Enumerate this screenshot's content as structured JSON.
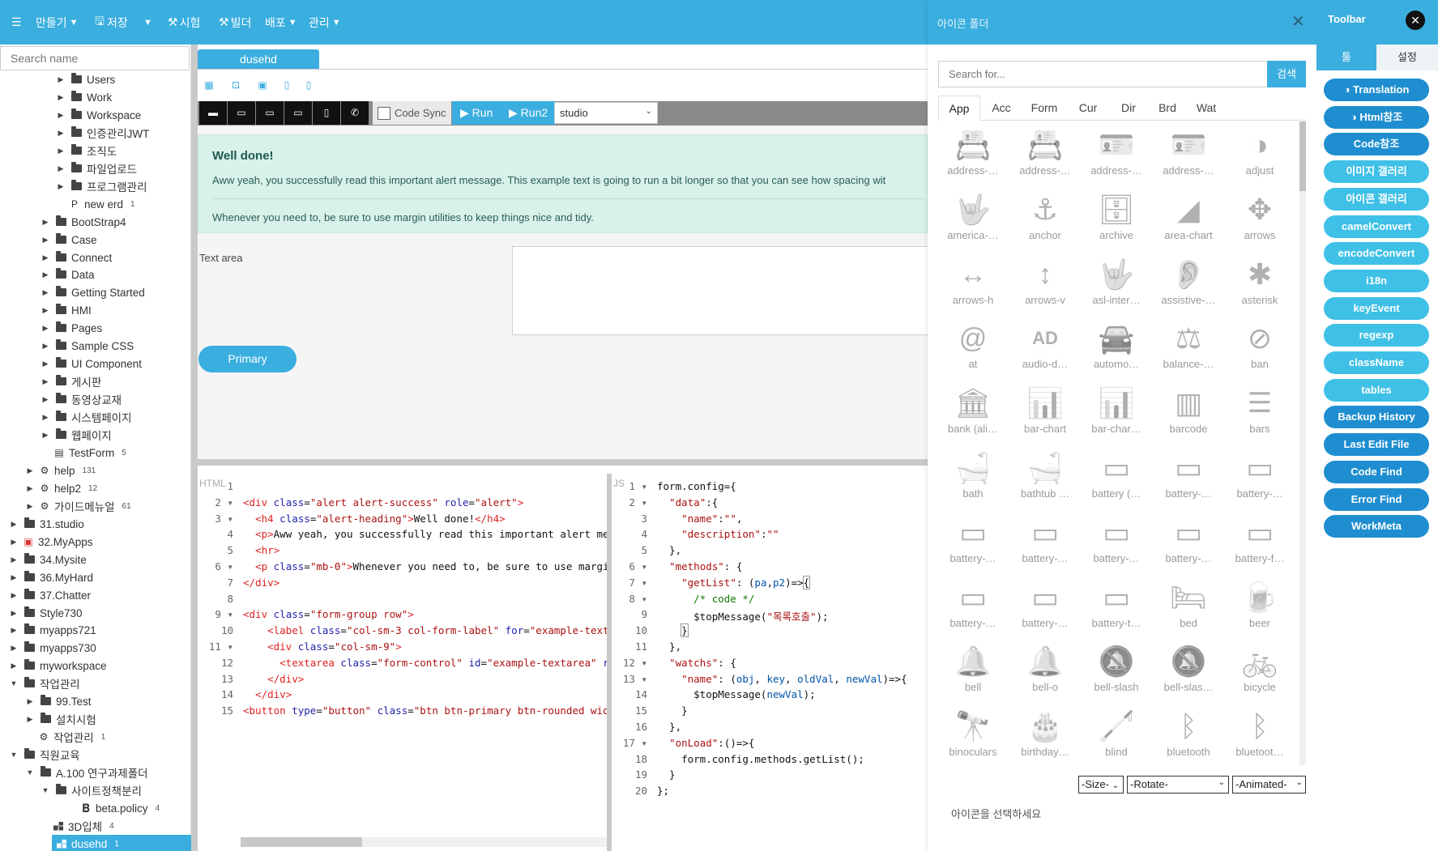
{
  "topbar": {
    "menu_icon": "hamburger-icon",
    "create": "만들기",
    "save": "저장",
    "test": "시험",
    "builder": "빌더",
    "deploy": "배포",
    "manage": "관리"
  },
  "sidebar": {
    "search_placeholder": "Search name",
    "items": [
      {
        "label": "Users",
        "type": "folder"
      },
      {
        "label": "Work",
        "type": "folder"
      },
      {
        "label": "Workspace",
        "type": "folder"
      },
      {
        "label": "인증관리JWT",
        "type": "folder"
      },
      {
        "label": "조직도",
        "type": "folder"
      },
      {
        "label": "파일업로드",
        "type": "folder"
      },
      {
        "label": "프로그램관리",
        "type": "folder"
      },
      {
        "label": "new erd",
        "count": "1",
        "type": "erd"
      },
      {
        "label": "BootStrap4",
        "type": "folder"
      },
      {
        "label": "Case",
        "type": "folder"
      },
      {
        "label": "Connect",
        "type": "folder"
      },
      {
        "label": "Data",
        "type": "folder"
      },
      {
        "label": "Getting Started",
        "type": "folder"
      },
      {
        "label": "HMI",
        "type": "folder"
      },
      {
        "label": "Pages",
        "type": "folder"
      },
      {
        "label": "Sample CSS",
        "type": "folder"
      },
      {
        "label": "UI Component",
        "type": "folder"
      },
      {
        "label": "게시판",
        "type": "folder"
      },
      {
        "label": "동영상교재",
        "type": "folder"
      },
      {
        "label": "시스템페이지",
        "type": "folder"
      },
      {
        "label": "웹페이지",
        "type": "folder"
      },
      {
        "label": "TestForm",
        "count": "5",
        "type": "form"
      },
      {
        "label": "help",
        "count": "131",
        "type": "cog"
      },
      {
        "label": "help2",
        "count": "12",
        "type": "cog"
      },
      {
        "label": "가이드메뉴얼",
        "count": "61",
        "type": "cog"
      },
      {
        "label": "31.studio",
        "type": "folder"
      },
      {
        "label": "32.MyApps",
        "type": "box"
      },
      {
        "label": "34.Mysite",
        "type": "folder"
      },
      {
        "label": "36.MyHard",
        "type": "folder"
      },
      {
        "label": "37.Chatter",
        "type": "folder"
      },
      {
        "label": "Style730",
        "type": "folder"
      },
      {
        "label": "myapps721",
        "type": "folder"
      },
      {
        "label": "myapps730",
        "type": "folder"
      },
      {
        "label": "myworkspace",
        "type": "folder"
      },
      {
        "label": "작업관리",
        "type": "folder"
      },
      {
        "label": "99.Test",
        "type": "folder"
      },
      {
        "label": "설치시험",
        "type": "folder"
      },
      {
        "label": "작업관리",
        "count": "1",
        "type": "cog"
      },
      {
        "label": "직원교육",
        "type": "folder"
      },
      {
        "label": "A.100 연구과제폴더",
        "type": "folder"
      },
      {
        "label": "사이트정책분리",
        "type": "folder"
      },
      {
        "label": "beta.policy",
        "count": "4",
        "type": "bold"
      },
      {
        "label": "3D입체",
        "count": "4",
        "type": "grid"
      },
      {
        "label": "dusehd",
        "count": "1",
        "type": "grid"
      }
    ]
  },
  "main": {
    "tab": "dusehd",
    "code_sync": "Code Sync",
    "run": "Run",
    "run2": "Run2",
    "studio": "studio",
    "alert_heading": "Well done!",
    "alert_text": "Aww yeah, you successfully read this important alert message. This example text is going to run a bit longer so that you can see how spacing wit",
    "alert_text2": "Whenever you need to, be sure to use margin utilities to keep things nice and tidy.",
    "textarea_label": "Text area",
    "primary": "Primary",
    "html_label": "HTML",
    "js_label": "JS"
  },
  "iconpanel": {
    "title": "아이콘 폴더",
    "search_placeholder": "Search for...",
    "search_button": "검색",
    "tabs": [
      "App",
      "Acc",
      "Form",
      "Cur",
      "Dir",
      "Brd",
      "Wat"
    ],
    "icons": [
      {
        "name": "address-…",
        "g": "📇"
      },
      {
        "name": "address-…",
        "g": "📇"
      },
      {
        "name": "address-…",
        "g": "🪪"
      },
      {
        "name": "address-…",
        "g": "🪪"
      },
      {
        "name": "adjust",
        "g": "◑"
      },
      {
        "name": "america-…",
        "g": "🤟"
      },
      {
        "name": "anchor",
        "g": "⚓"
      },
      {
        "name": "archive",
        "g": "🗄"
      },
      {
        "name": "area-chart",
        "g": "◢"
      },
      {
        "name": "arrows",
        "g": "✥"
      },
      {
        "name": "arrows-h",
        "g": "↔"
      },
      {
        "name": "arrows-v",
        "g": "↕"
      },
      {
        "name": "asl-inter…",
        "g": "🤟"
      },
      {
        "name": "assistive-…",
        "g": "👂"
      },
      {
        "name": "asterisk",
        "g": "✱"
      },
      {
        "name": "at",
        "g": "@"
      },
      {
        "name": "audio-d…",
        "g": "AD"
      },
      {
        "name": "automo…",
        "g": "🚘"
      },
      {
        "name": "balance-…",
        "g": "⚖"
      },
      {
        "name": "ban",
        "g": "⊘"
      },
      {
        "name": "bank (ali…",
        "g": "🏛"
      },
      {
        "name": "bar-chart",
        "g": "📊"
      },
      {
        "name": "bar-char…",
        "g": "📊"
      },
      {
        "name": "barcode",
        "g": "▥"
      },
      {
        "name": "bars",
        "g": "☰"
      },
      {
        "name": "bath",
        "g": "🛁"
      },
      {
        "name": "bathtub …",
        "g": "🛁"
      },
      {
        "name": "battery (…",
        "g": "▭"
      },
      {
        "name": "battery-…",
        "g": "▭"
      },
      {
        "name": "battery-…",
        "g": "▭"
      },
      {
        "name": "battery-…",
        "g": "▭"
      },
      {
        "name": "battery-…",
        "g": "▭"
      },
      {
        "name": "battery-…",
        "g": "▭"
      },
      {
        "name": "battery-…",
        "g": "▭"
      },
      {
        "name": "battery-f…",
        "g": "▭"
      },
      {
        "name": "battery-…",
        "g": "▭"
      },
      {
        "name": "battery-…",
        "g": "▭"
      },
      {
        "name": "battery-t…",
        "g": "▭"
      },
      {
        "name": "bed",
        "g": "🛏"
      },
      {
        "name": "beer",
        "g": "🍺"
      },
      {
        "name": "bell",
        "g": "🔔"
      },
      {
        "name": "bell-o",
        "g": "🔔"
      },
      {
        "name": "bell-slash",
        "g": "🔕"
      },
      {
        "name": "bell-slas…",
        "g": "🔕"
      },
      {
        "name": "bicycle",
        "g": "🚲"
      },
      {
        "name": "binoculars",
        "g": "🔭"
      },
      {
        "name": "birthday…",
        "g": "🎂"
      },
      {
        "name": "blind",
        "g": "🦯"
      },
      {
        "name": "bluetooth",
        "g": "ᛒ"
      },
      {
        "name": "bluetoot…",
        "g": "ᛒ"
      }
    ],
    "size": "-Size-",
    "rotate": "-Rotate-",
    "animated": "-Animated-",
    "message": "아이콘을 선택하세요"
  },
  "toolbar": {
    "title": "Toolbar",
    "tab_tool": "툴",
    "tab_settings": "설정",
    "buttons": [
      "Translation",
      "Html참조",
      "Code참조",
      "이미지 갤러리",
      "아이콘 갤러리",
      "camelConvert",
      "encodeConvert",
      "i18n",
      "keyEvent",
      "regexp",
      "className",
      "tables",
      "Backup History",
      "Last Edit File",
      "Code Find",
      "Error Find",
      "WorkMeta"
    ]
  },
  "colors": {
    "brand": "#3aaedf",
    "dark_button": "#1f8ed0",
    "light_button": "#3fc0e6",
    "alert_bg": "#d9f1eb"
  }
}
